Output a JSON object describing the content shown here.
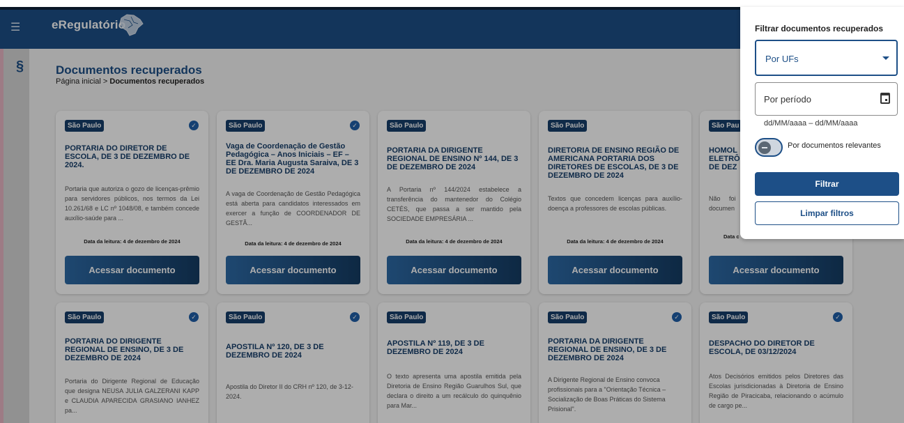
{
  "app": {
    "name": "eRegulatório",
    "menu_icon": "☰",
    "section_icon": "§"
  },
  "header": {
    "title": "Documentos recuperados",
    "breadcrumb_home": "Página inicial",
    "breadcrumb_sep": " > ",
    "breadcrumb_current": "Documentos recuperados"
  },
  "cards": [
    {
      "badge": "São Paulo",
      "title": "PORTARIA DO DIRETOR DE ESCOLA, DE 3 DE DEZEMBRO DE 2024.",
      "desc": "Portaria que autoriza o gozo de licenças-prêmio para servidores públicos, nos termos da Lei 10.261/68 e LC nº 1048/08, e também concede auxílio-saúde para ...",
      "date": "Data da leitura: 4 de dezembro de 2024",
      "button": "Acessar documento",
      "checked": true
    },
    {
      "badge": "São Paulo",
      "title": "Vaga de Coordenação de Gestão Pedagógica – Anos Iniciais – EF – EE Dra. Maria Augusta Saraiva, DE 3 DE DEZEMBRO DE 2024",
      "desc": "A vaga de Coordenação de Gestão Pedagógica está aberta para candidatos interessados em exercer a função de COORDENADOR DE GESTÃ...",
      "date": "Data da leitura: 4 de dezembro de 2024",
      "button": "Acessar documento",
      "checked": true
    },
    {
      "badge": "São Paulo",
      "title": "PORTARIA DA DIRIGENTE REGIONAL DE ENSINO Nº 144, DE 3 DE DEZEMBRO DE 2024",
      "desc": "A Portaria nº 144/2024 estabelece a transferência do mantenedor do Colégio CETÉS, que passa a ser mantido pela SOCIEDADE EMPRESÁRIA ...",
      "date": "Data da leitura: 4 de dezembro de 2024",
      "button": "Acessar documento",
      "checked": false
    },
    {
      "badge": "São Paulo",
      "title": "DIRETORIA DE ENSINO REGIÃO DE AMERICANA PORTARIA DOS DIRETORES DE ESCOLAS, DE 3 DE DEZEMBRO DE 2024",
      "desc": "Textos que concedem licenças para auxílio-doença a professores de escolas públicas.",
      "date": "Data da leitura: 4 de dezembro de 2024",
      "button": "Acessar documento",
      "checked": false
    },
    {
      "badge": "São Pau",
      "title": "HOMOL ELETRÔ DE DEZ",
      "desc": "Não foi p documen",
      "date": "Data c",
      "button": "Acessar documento",
      "checked": false
    },
    {
      "badge": "São Paulo",
      "title": "PORTARIA DO DIRIGENTE REGIONAL DE ENSINO, DE 3 DE DEZEMBRO DE 2024",
      "desc": "Portaria do Dirigente Regional de Educação que designa NEUSA JULIA GALZERANI KAPP e CLAUDIA APARECIDA GRASIANO IANHEZ pa...",
      "date": "",
      "button": "",
      "checked": true
    },
    {
      "badge": "São Paulo",
      "title": "APOSTILA Nº 120, DE 3 DE DEZEMBRO DE 2024",
      "desc": "Apostila do Diretor II do CRH nº 120, de 3-12-2024.",
      "date": "",
      "button": "",
      "checked": true
    },
    {
      "badge": "São Paulo",
      "title": "APOSTILA Nº 119, DE 3 DE DEZEMBRO DE 2024",
      "desc": "O texto apresenta uma apostila emitida pela Diretoria de Ensino Região Guarulhos Sul, que declara o direito a um recálculo do quinquênio para Mar...",
      "date": "",
      "button": "",
      "checked": false
    },
    {
      "badge": "São Paulo",
      "title": "PORTARIA DA DIRIGENTE REGIONAL DE ENSINO, DE 3 DE DEZEMBRO DE 2024",
      "desc": "A Dirigente Regional de Ensino convoca profissionais para a \"Orientação Técnica – Socialização de Boas Práticas do Sistema Prisional\".",
      "date": "",
      "button": "",
      "checked": true
    },
    {
      "badge": "São Paulo",
      "title": "DESPACHO DO DIRETOR DE ESCOLA, DE 03/12/2024",
      "desc": "Atos Decisórios emitidos pelos Diretores das Escolas jurisdicionadas à Diretoria de Ensino Região de Piracicaba, relacionando o acúmulo de cargo pe...",
      "date": "",
      "button": "",
      "checked": true
    }
  ],
  "filter": {
    "title": "Filtrar documentos recuperados",
    "uf_select": "Por UFs",
    "period_label": "Por período",
    "period_hint": "dd/MM/aaaa – dd/MM/aaaa",
    "relevant_toggle": "Por documentos relevantes",
    "filter_button": "Filtrar",
    "clear_button": "Limpar filtros"
  },
  "colors": {
    "primary": "#1d4f87",
    "badge": "#173f6b"
  }
}
